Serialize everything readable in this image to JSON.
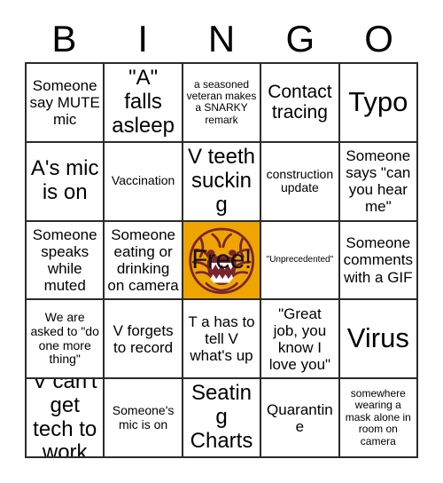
{
  "card": {
    "title": "BINGO",
    "header_letters": [
      "B",
      "I",
      "N",
      "G",
      "O"
    ],
    "colors": {
      "free_space_background": "#efa500",
      "grid_line": "#2b2b2b",
      "cell_background": "#ffffff",
      "text": "#000000",
      "mascot_dark": "#7a2430",
      "mascot_fill": "#efa500"
    },
    "free_space": {
      "label": "Free!",
      "icon": "tiger-mascot-icon"
    },
    "rows": [
      [
        {
          "text": "Someone say MUTE mic",
          "size": "s-m"
        },
        {
          "text": "\"A\" falls asleep",
          "size": "s-xl"
        },
        {
          "text": "a seasoned veteran makes a SNARKY remark",
          "size": "s-xs"
        },
        {
          "text": "Contact tracing",
          "size": "s-l"
        },
        {
          "text": "Typo",
          "size": "s-xxl"
        }
      ],
      [
        {
          "text": "A's mic is on",
          "size": "s-xl"
        },
        {
          "text": "Vaccination",
          "size": "s-s"
        },
        {
          "text": "V teeth sucking",
          "size": "s-xl"
        },
        {
          "text": "construction update",
          "size": "s-s"
        },
        {
          "text": "Someone says \"can you hear me\"",
          "size": "s-m"
        }
      ],
      [
        {
          "text": "Someone speaks while muted",
          "size": "s-m"
        },
        {
          "text": "Someone eating or drinking on camera",
          "size": "s-m"
        },
        {
          "text": "Free!",
          "size": "free"
        },
        {
          "text": "\"Unprecedented\"",
          "size": "s-xxs"
        },
        {
          "text": "Someone comments with a GIF",
          "size": "s-m"
        }
      ],
      [
        {
          "text": "We are asked to \"do one more thing\"",
          "size": "s-s"
        },
        {
          "text": "V forgets to record",
          "size": "s-m"
        },
        {
          "text": "T a has to tell V what's up",
          "size": "s-m"
        },
        {
          "text": "\"Great job, you know I love you\"",
          "size": "s-m"
        },
        {
          "text": "Virus",
          "size": "s-xxl"
        }
      ],
      [
        {
          "text": "V can't get tech to work",
          "size": "s-xl"
        },
        {
          "text": "Someone's mic is on",
          "size": "s-s"
        },
        {
          "text": "Seating Charts",
          "size": "s-xl"
        },
        {
          "text": "Quarantine",
          "size": "s-m"
        },
        {
          "text": "somewhere wearing a mask alone in room on camera",
          "size": "s-xs"
        }
      ]
    ]
  }
}
